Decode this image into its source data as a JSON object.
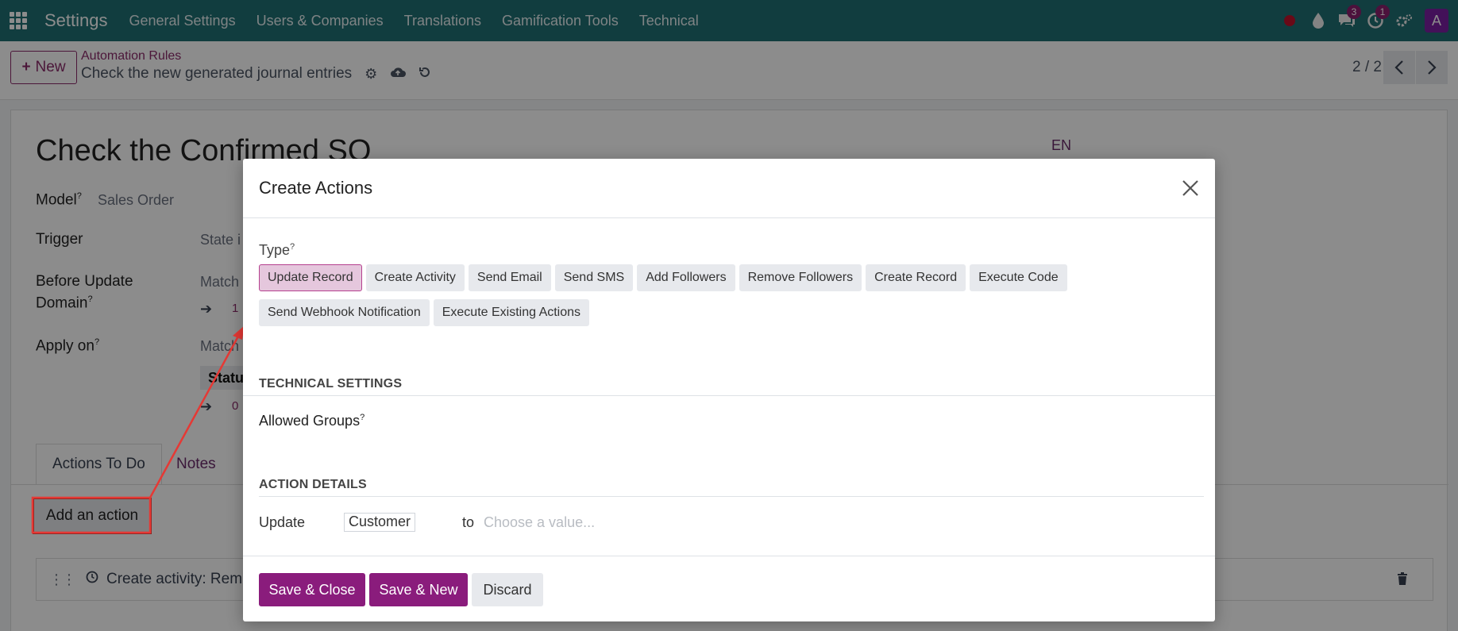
{
  "navbar": {
    "app_name": "Settings",
    "menus": [
      "General Settings",
      "Users & Companies",
      "Translations",
      "Gamification Tools",
      "Technical"
    ],
    "messages_badge": "3",
    "activities_badge": "1",
    "avatar_letter": "A"
  },
  "control_panel": {
    "new_label": "New",
    "breadcrumb_parent": "Automation Rules",
    "breadcrumb_current": "Check the new generated journal entries",
    "pager": "2 / 2"
  },
  "form": {
    "title": "Check the Confirmed SO",
    "lang": "EN",
    "model_label": "Model",
    "model_value": "Sales Order",
    "trigger_label": "Trigger",
    "trigger_value": "State i",
    "before_update_label_1": "Before Update",
    "before_update_label_2": "Domain",
    "before_update_value": "Match",
    "before_update_count": "1",
    "apply_on_label": "Apply on",
    "apply_on_value": "Match",
    "apply_on_sub": "Statu",
    "apply_on_count": "0",
    "tabs": [
      "Actions To Do",
      "Notes"
    ],
    "add_action_label": "Add an action",
    "action_row_label": "Create activity: Remind"
  },
  "modal": {
    "title": "Create Actions",
    "type_label": "Type",
    "types": [
      "Update Record",
      "Create Activity",
      "Send Email",
      "Send SMS",
      "Add Followers",
      "Remove Followers",
      "Create Record",
      "Execute Code",
      "Send Webhook Notification",
      "Execute Existing Actions"
    ],
    "selected_type": "Update Record",
    "technical_settings": "TECHNICAL SETTINGS",
    "allowed_groups": "Allowed Groups",
    "action_details": "ACTION DETAILS",
    "update_label": "Update",
    "update_field": "Customer",
    "to_label": "to",
    "value_placeholder": "Choose a value...",
    "save_close": "Save & Close",
    "save_new": "Save & New",
    "discard": "Discard"
  },
  "colors": {
    "navbar": "#1f6f73",
    "primary": "#8a1c7c",
    "annotation": "#e53935"
  }
}
